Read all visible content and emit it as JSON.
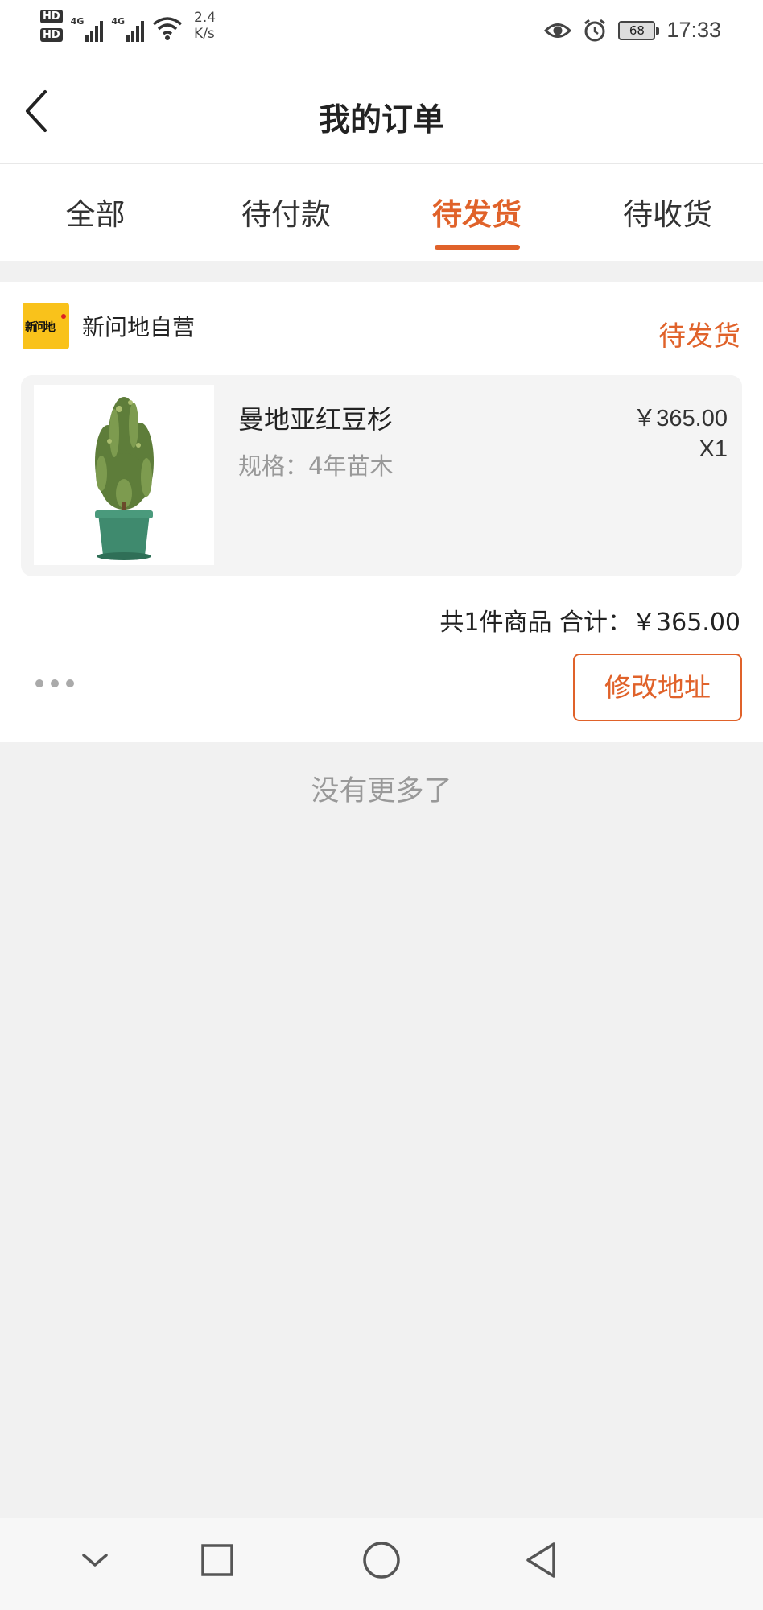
{
  "status_bar": {
    "network_speed_value": "2.4",
    "network_speed_unit": "K/s",
    "signal_label_1": "4G",
    "signal_label_2": "4G",
    "hd_label_1": "HD",
    "hd_label_2": "HD",
    "battery": "68",
    "time": "17:33"
  },
  "header": {
    "title": "我的订单",
    "back_icon": "chevron-left-icon"
  },
  "tabs": [
    {
      "label": "全部",
      "active": false
    },
    {
      "label": "待付款",
      "active": false
    },
    {
      "label": "待发货",
      "active": true
    },
    {
      "label": "待收货",
      "active": false
    }
  ],
  "order": {
    "shop_name": "新问地自营",
    "shop_logo_text": "新问地",
    "status": "待发货",
    "item": {
      "name": "曼地亚红豆杉",
      "spec": "规格：4年苗木",
      "price": "￥365.00",
      "quantity": "X1"
    },
    "summary": "共1件商品  合计：￥365.00",
    "action_button": "修改地址"
  },
  "footer_text": "没有更多了",
  "colors": {
    "accent": "#e0622a",
    "background": "#f1f1f1",
    "card": "#ffffff",
    "item_bg": "#f4f4f4",
    "logo": "#f9c21b"
  }
}
